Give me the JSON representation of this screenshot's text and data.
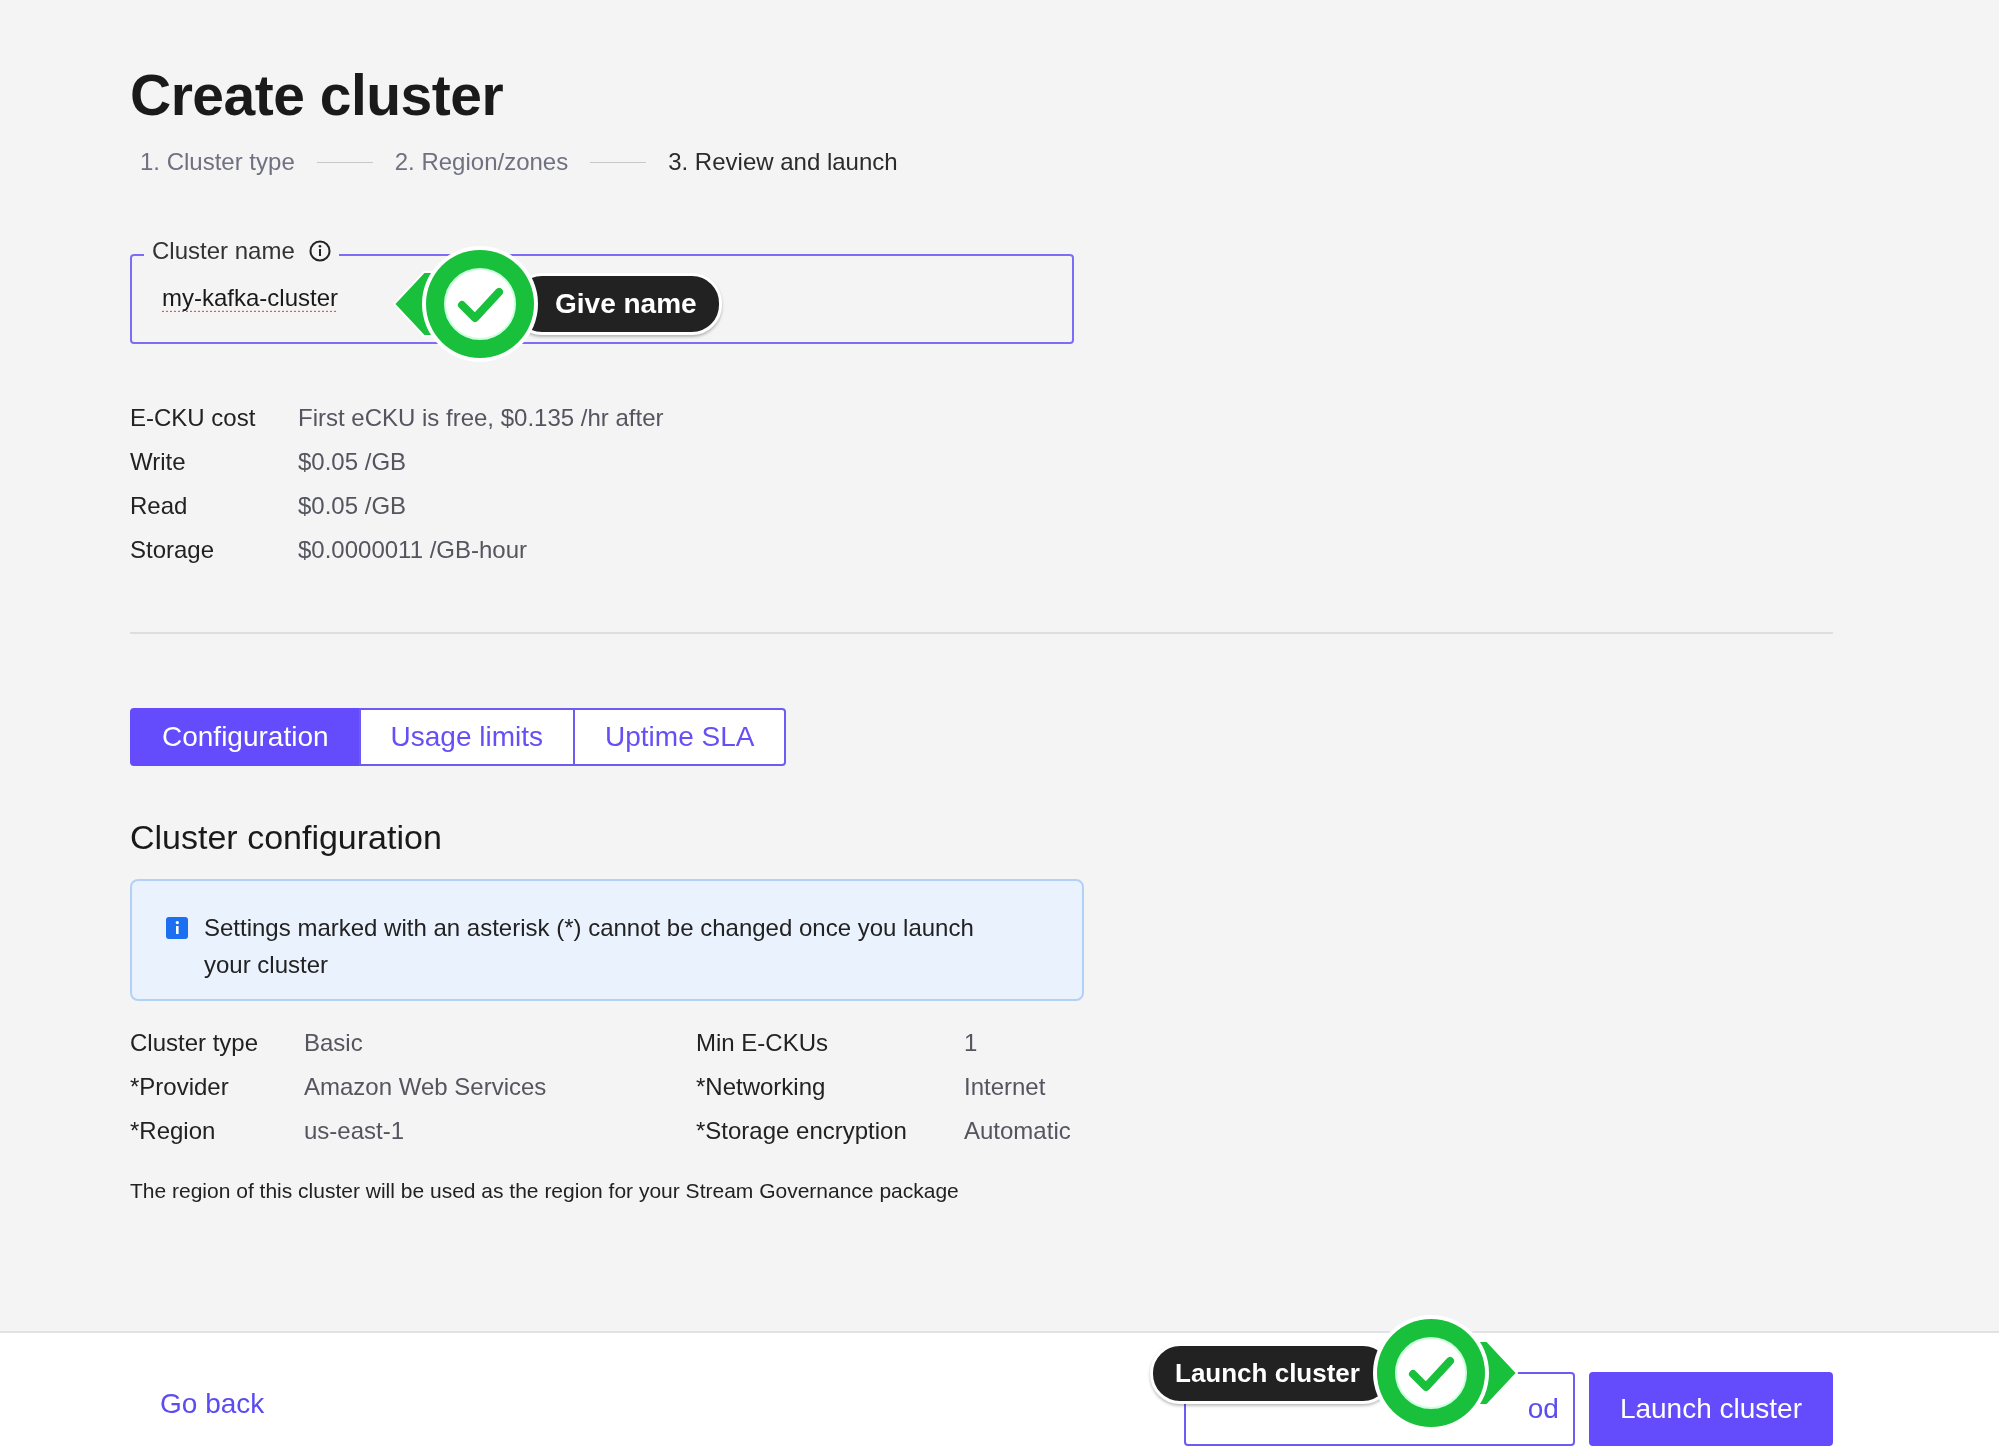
{
  "title": "Create cluster",
  "steps": [
    {
      "label": "1. Cluster type",
      "selected": false
    },
    {
      "label": "2. Region/zones",
      "selected": false
    },
    {
      "label": "3. Review and launch",
      "selected": true
    }
  ],
  "cluster_name": {
    "label": "Cluster name",
    "value": "my-kafka-cluster",
    "callout": {
      "label": "Give name",
      "kind": "left"
    }
  },
  "pricing": [
    {
      "label": "E-CKU cost",
      "value": "First eCKU is free, $0.135 /hr after"
    },
    {
      "label": "Write",
      "value": "$0.05 /GB"
    },
    {
      "label": "Read",
      "value": "$0.05 /GB"
    },
    {
      "label": "Storage",
      "value": "$0.0000011 /GB-hour"
    }
  ],
  "tabs": [
    {
      "label": "Configuration",
      "selected": true
    },
    {
      "label": "Usage limits",
      "selected": false
    },
    {
      "label": "Uptime SLA",
      "selected": false
    }
  ],
  "section_title": "Cluster configuration",
  "notice": "Settings marked with an asterisk (*) cannot be changed once you launch your cluster",
  "config": [
    {
      "label": "Cluster type",
      "value": "Basic"
    },
    {
      "label": "Min E-CKUs",
      "value": "1"
    },
    {
      "label": "*Provider",
      "value": "Amazon Web Services"
    },
    {
      "label": "*Networking",
      "value": "Internet"
    },
    {
      "label": "*Region",
      "value": "us-east-1"
    },
    {
      "label": "*Storage encryption",
      "value": "Automatic"
    }
  ],
  "footnote": "The region of this cluster will be used as the region for your Stream Governance package",
  "footer": {
    "back_link": "Go back",
    "buttons": [
      {
        "label": "od",
        "kind": "secondary"
      },
      {
        "label": "Launch cluster",
        "kind": "primary"
      }
    ],
    "callout": {
      "label": "Launch cluster",
      "kind": "right"
    }
  }
}
